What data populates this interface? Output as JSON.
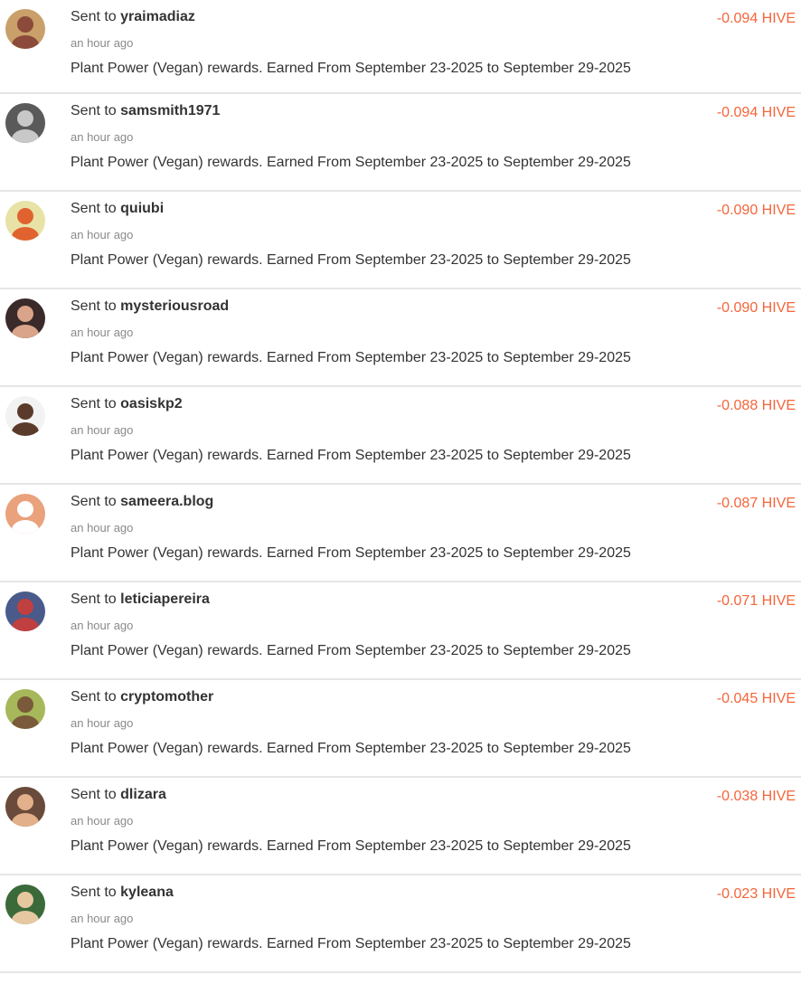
{
  "colors": {
    "amount": "#f4653a",
    "text": "#333333",
    "muted": "#8a8a8a",
    "divider": "#e6e6e6"
  },
  "transactions": [
    {
      "prefix": "Sent to",
      "user": "yraimadiaz",
      "time": "an hour ago",
      "memo": "Plant Power (Vegan) rewards. Earned From September 23-2025 to September 29-2025",
      "amount": "-0.094 HIVE",
      "avatar_icon": "user-avatar",
      "avatar_colors": [
        "#c9a06a",
        "#8b4a3a"
      ]
    },
    {
      "prefix": "Sent to",
      "user": "samsmith1971",
      "time": "an hour ago",
      "memo": "Plant Power (Vegan) rewards. Earned From September 23-2025 to September 29-2025",
      "amount": "-0.094 HIVE",
      "avatar_icon": "user-avatar",
      "avatar_colors": [
        "#5a5a5a",
        "#c8c8c8"
      ]
    },
    {
      "prefix": "Sent to",
      "user": "quiubi",
      "time": "an hour ago",
      "memo": "Plant Power (Vegan) rewards. Earned From September 23-2025 to September 29-2025",
      "amount": "-0.090 HIVE",
      "avatar_icon": "user-avatar",
      "avatar_colors": [
        "#e8e2a6",
        "#e0632f"
      ]
    },
    {
      "prefix": "Sent to",
      "user": "mysteriousroad",
      "time": "an hour ago",
      "memo": "Plant Power (Vegan) rewards. Earned From September 23-2025 to September 29-2025",
      "amount": "-0.090 HIVE",
      "avatar_icon": "user-avatar",
      "avatar_colors": [
        "#3a2a2a",
        "#d9a48a"
      ]
    },
    {
      "prefix": "Sent to",
      "user": "oasiskp2",
      "time": "an hour ago",
      "memo": "Plant Power (Vegan) rewards. Earned From September 23-2025 to September 29-2025",
      "amount": "-0.088 HIVE",
      "avatar_icon": "user-avatar",
      "avatar_colors": [
        "#f2f2f2",
        "#5a3a2a"
      ]
    },
    {
      "prefix": "Sent to",
      "user": "sameera.blog",
      "time": "an hour ago",
      "memo": "Plant Power (Vegan) rewards. Earned From September 23-2025 to September 29-2025",
      "amount": "-0.087 HIVE",
      "avatar_icon": "user-avatar",
      "avatar_colors": [
        "#e9a27c",
        "#ffffff"
      ]
    },
    {
      "prefix": "Sent to",
      "user": "leticiapereira",
      "time": "an hour ago",
      "memo": "Plant Power (Vegan) rewards. Earned From September 23-2025 to September 29-2025",
      "amount": "-0.071 HIVE",
      "avatar_icon": "user-avatar",
      "avatar_colors": [
        "#4a5a8a",
        "#c04040"
      ]
    },
    {
      "prefix": "Sent to",
      "user": "cryptomother",
      "time": "an hour ago",
      "memo": "Plant Power (Vegan) rewards. Earned From September 23-2025 to September 29-2025",
      "amount": "-0.045 HIVE",
      "avatar_icon": "user-avatar",
      "avatar_colors": [
        "#a6b85a",
        "#7a5a3a"
      ]
    },
    {
      "prefix": "Sent to",
      "user": "dlizara",
      "time": "an hour ago",
      "memo": "Plant Power (Vegan) rewards. Earned From September 23-2025 to September 29-2025",
      "amount": "-0.038 HIVE",
      "avatar_icon": "user-avatar",
      "avatar_colors": [
        "#6a4a3a",
        "#e2b08a"
      ]
    },
    {
      "prefix": "Sent to",
      "user": "kyleana",
      "time": "an hour ago",
      "memo": "Plant Power (Vegan) rewards. Earned From September 23-2025 to September 29-2025",
      "amount": "-0.023 HIVE",
      "avatar_icon": "user-avatar",
      "avatar_colors": [
        "#3a6a3a",
        "#e6c8a0"
      ]
    }
  ]
}
